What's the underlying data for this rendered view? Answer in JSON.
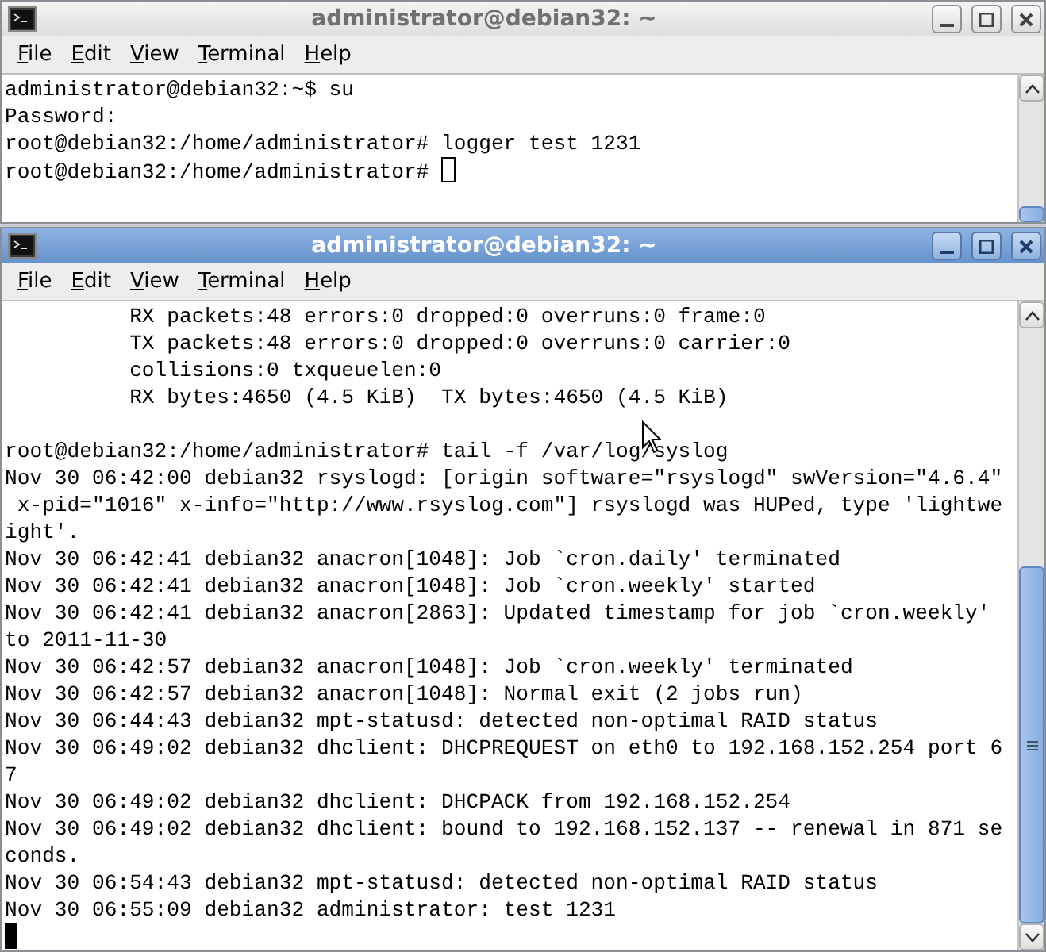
{
  "windows": [
    {
      "title": "administrator@debian32: ~",
      "focused": false,
      "menu": [
        "File",
        "Edit",
        "View",
        "Terminal",
        "Help"
      ],
      "output_blocks": [
        [
          "administrator@debian32:~$ su",
          "Password:",
          "root@debian32:/home/administrator# logger test 1231",
          "root@debian32:/home/administrator# "
        ]
      ],
      "cursor_on_new_line": false
    },
    {
      "title": "administrator@debian32: ~",
      "focused": true,
      "menu": [
        "File",
        "Edit",
        "View",
        "Terminal",
        "Help"
      ],
      "output_blocks": [
        [
          "          RX packets:48 errors:0 dropped:0 overruns:0 frame:0",
          "          TX packets:48 errors:0 dropped:0 overruns:0 carrier:0",
          "          collisions:0 txqueuelen:0",
          "          RX bytes:4650 (4.5 KiB)  TX bytes:4650 (4.5 KiB)"
        ],
        [
          "root@debian32:/home/administrator# tail -f /var/log/syslog",
          "Nov 30 06:42:00 debian32 rsyslogd: [origin software=\"rsyslogd\" swVersion=\"4.6.4\"",
          " x-pid=\"1016\" x-info=\"http://www.rsyslog.com\"] rsyslogd was HUPed, type 'lightwe",
          "ight'.",
          "Nov 30 06:42:41 debian32 anacron[1048]: Job `cron.daily' terminated",
          "Nov 30 06:42:41 debian32 anacron[1048]: Job `cron.weekly' started",
          "Nov 30 06:42:41 debian32 anacron[2863]: Updated timestamp for job `cron.weekly'",
          "to 2011-11-30",
          "Nov 30 06:42:57 debian32 anacron[1048]: Job `cron.weekly' terminated",
          "Nov 30 06:42:57 debian32 anacron[1048]: Normal exit (2 jobs run)",
          "Nov 30 06:44:43 debian32 mpt-statusd: detected non-optimal RAID status",
          "Nov 30 06:49:02 debian32 dhclient: DHCPREQUEST on eth0 to 192.168.152.254 port 6",
          "7",
          "Nov 30 06:49:02 debian32 dhclient: DHCPACK from 192.168.152.254",
          "Nov 30 06:49:02 debian32 dhclient: bound to 192.168.152.137 -- renewal in 871 se",
          "conds.",
          "Nov 30 06:54:43 debian32 mpt-statusd: detected non-optimal RAID status",
          "Nov 30 06:55:09 debian32 administrator: test 1231"
        ]
      ],
      "cursor_on_new_line": true
    }
  ]
}
